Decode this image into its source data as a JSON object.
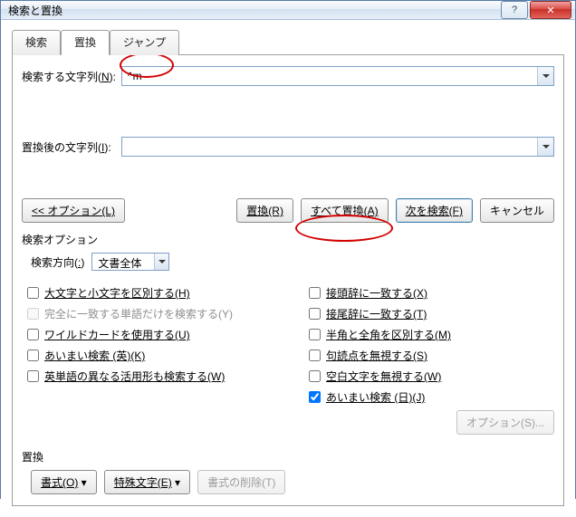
{
  "window": {
    "title": "検索と置換"
  },
  "tabs": {
    "find": "検索",
    "replace": "置換",
    "jump": "ジャンプ"
  },
  "fields": {
    "find_label_pre": "検索する文字列(",
    "find_label_key": "N",
    "find_label_post": "):",
    "find_value": "^m",
    "replace_label_pre": "置換後の文字列(",
    "replace_label_key": "I",
    "replace_label_post": "):",
    "replace_value": ""
  },
  "buttons": {
    "options_less": "<< オプション(L)",
    "replace": "置換(R)",
    "replace_all": "すべて置換(A)",
    "find_next": "次を検索(F)",
    "cancel": "キャンセル",
    "options_s": "オプション(S)...",
    "format": "書式(O)",
    "special": "特殊文字(E)",
    "clear_format": "書式の削除(T)"
  },
  "options_header": "検索オプション",
  "direction": {
    "label_pre": "検索方向(",
    "label_key": ":",
    "label_post": ")",
    "value": "文書全体"
  },
  "checks_left": {
    "match_case": "大文字と小文字を区別する(H)",
    "whole_word": "完全に一致する単語だけを検索する(Y)",
    "wildcards": "ワイルドカードを使用する(U)",
    "fuzzy_en": "あいまい検索 (英)(K)",
    "word_forms": "英単語の異なる活用形も検索する(W)"
  },
  "checks_right": {
    "match_prefix": "接頭辞に一致する(X)",
    "match_suffix": "接尾辞に一致する(T)",
    "ignore_width": "半角と全角を区別する(M)",
    "ignore_punct": "句読点を無視する(S)",
    "ignore_space": "空白文字を無視する(W)",
    "fuzzy_jp": "あいまい検索 (日)(J)"
  },
  "replace_section": "置換"
}
